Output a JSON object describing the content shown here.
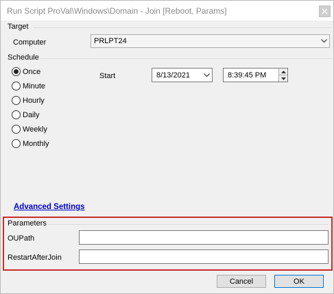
{
  "window": {
    "title": "Run Script ProVal\\Windows\\Domain - Join [Reboot, Params]"
  },
  "target": {
    "section_label": "Target",
    "computer_label": "Computer",
    "computer_value": "PRLPT24"
  },
  "schedule": {
    "section_label": "Schedule",
    "options": [
      {
        "label": "Once",
        "checked": true
      },
      {
        "label": "Minute",
        "checked": false
      },
      {
        "label": "Hourly",
        "checked": false
      },
      {
        "label": "Daily",
        "checked": false
      },
      {
        "label": "Weekly",
        "checked": false
      },
      {
        "label": "Monthly",
        "checked": false
      }
    ],
    "start_label": "Start",
    "start_date": "8/13/2021",
    "start_time": "8:39:45 PM"
  },
  "advanced_settings_label": "Advanced Settings",
  "parameters": {
    "section_label": "Parameters",
    "fields": [
      {
        "label": "OUPath",
        "value": ""
      },
      {
        "label": "RestartAfterJoin",
        "value": ""
      }
    ]
  },
  "buttons": {
    "cancel_label": "Cancel",
    "ok_label": "OK"
  },
  "colors": {
    "highlight_border": "#cc2a2a",
    "link": "#0000cc"
  }
}
